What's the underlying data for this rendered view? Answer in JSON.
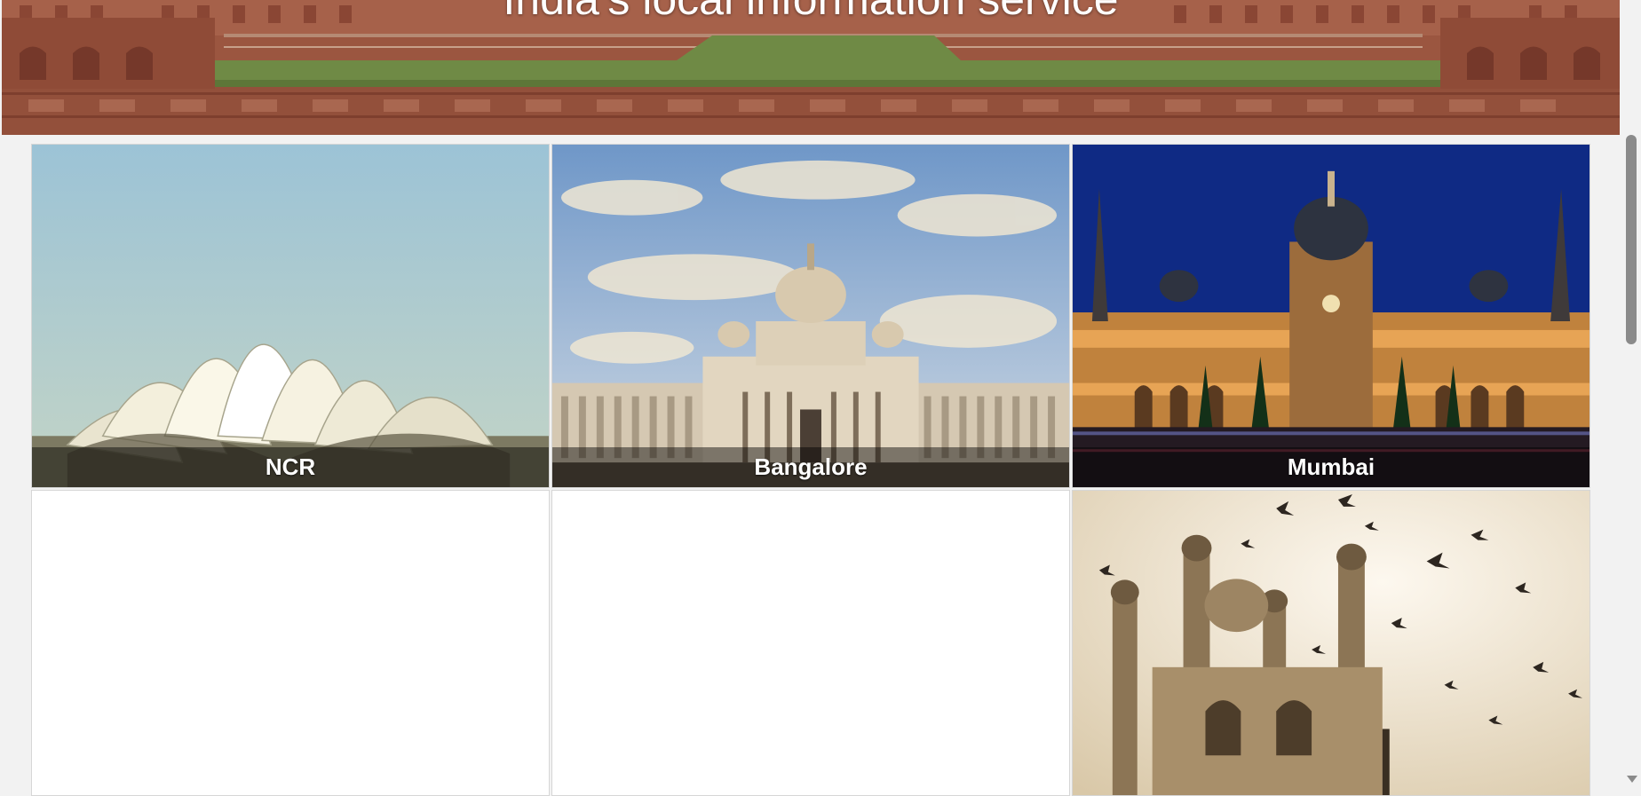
{
  "banner": {
    "title": "India's local information service"
  },
  "cities": [
    {
      "name": "NCR"
    },
    {
      "name": "Bangalore"
    },
    {
      "name": "Mumbai"
    },
    {
      "name": ""
    },
    {
      "name": ""
    },
    {
      "name": ""
    }
  ],
  "colors": {
    "banner_brick": "#a05a44",
    "caption_overlay": "rgba(0,0,0,0.45)",
    "page_background": "#f2f2f2",
    "tile_background": "#ffffff"
  }
}
